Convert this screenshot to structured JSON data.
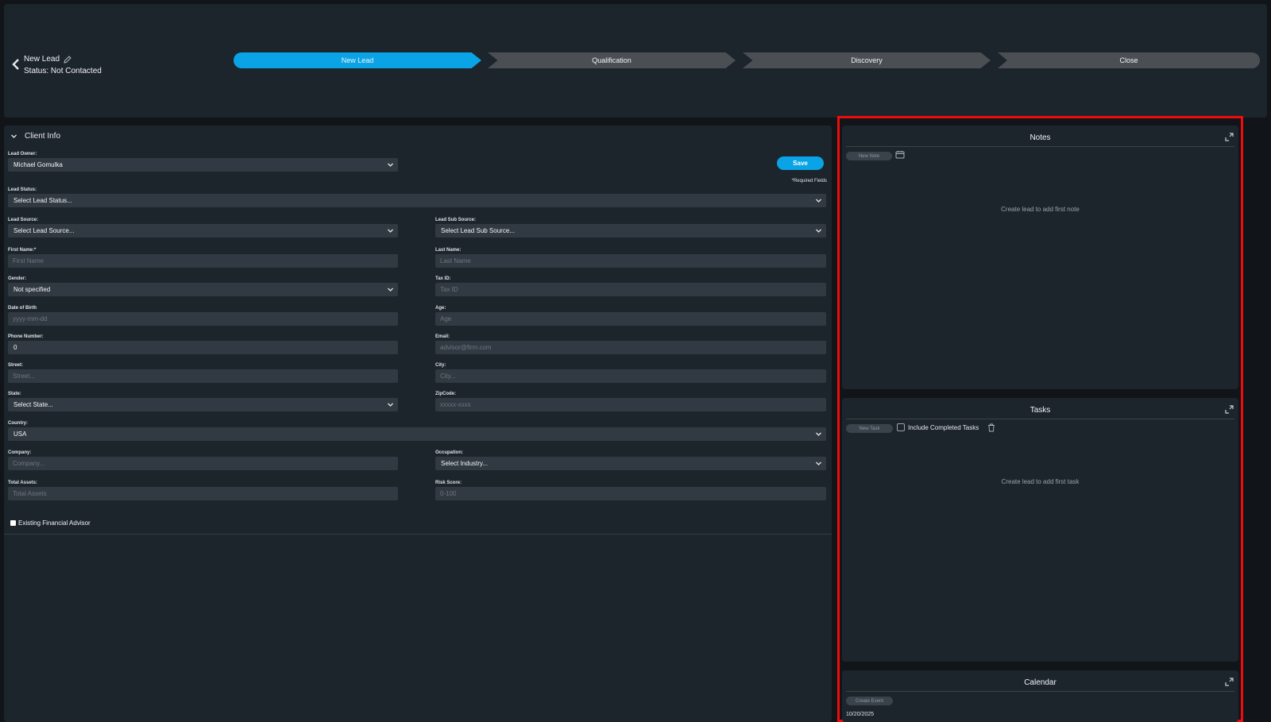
{
  "header": {
    "lead_title": "New Lead",
    "lead_status": "Status: Not Contacted",
    "steps": [
      "New Lead",
      "Qualification",
      "Discovery",
      "Close"
    ]
  },
  "client_info": {
    "section_title": "Client Info",
    "save_label": "Save",
    "required_note": "*Required Fields",
    "fields": {
      "lead_owner": {
        "label": "Lead Owner:",
        "value": "Michael Gomulka"
      },
      "lead_status": {
        "label": "Lead Status:",
        "value": "Select Lead Status..."
      },
      "lead_source": {
        "label": "Lead Source:",
        "value": "Select Lead Source..."
      },
      "lead_sub_source": {
        "label": "Lead Sub Source:",
        "value": "Select Lead Sub Source..."
      },
      "first_name": {
        "label": "First Name:*",
        "placeholder": "First Name"
      },
      "last_name": {
        "label": "Last Name:",
        "placeholder": "Last Name"
      },
      "gender": {
        "label": "Gender:",
        "value": "Not specified"
      },
      "tax_id": {
        "label": "Tax ID:",
        "placeholder": "Tax ID"
      },
      "dob": {
        "label": "Date of Birth",
        "placeholder": "yyyy-mm-dd"
      },
      "age": {
        "label": "Age:",
        "placeholder": "Age"
      },
      "phone": {
        "label": "Phone Number:",
        "value": "0"
      },
      "email": {
        "label": "Email:",
        "placeholder": "advisor@firm.com"
      },
      "street": {
        "label": "Street:",
        "placeholder": "Street..."
      },
      "city": {
        "label": "City:",
        "placeholder": "City..."
      },
      "state": {
        "label": "State:",
        "value": "Select State..."
      },
      "zip": {
        "label": "ZipCode:",
        "placeholder": "xxxxx-xxxx"
      },
      "country": {
        "label": "Country:",
        "value": "USA"
      },
      "company": {
        "label": "Company:",
        "placeholder": "Company..."
      },
      "occupation": {
        "label": "Occupation:",
        "value": "Select Industry..."
      },
      "total_assets": {
        "label": "Total Assets:",
        "placeholder": "Total Assets"
      },
      "risk_score": {
        "label": "Risk Score:",
        "placeholder": "0-100"
      }
    },
    "existing_advisor_label": "Existing Financial Advisor"
  },
  "notes": {
    "title": "Notes",
    "new_button": "New Note",
    "empty_message": "Create lead to add first note"
  },
  "tasks": {
    "title": "Tasks",
    "new_button": "New Task",
    "include_completed_label": "Include Completed Tasks",
    "empty_message": "Create lead to add first task"
  },
  "calendar": {
    "title": "Calendar",
    "create_button": "Create Event",
    "date": "10/20/2025"
  },
  "colors": {
    "accent": "#0aa3e6",
    "highlight": "#ef0c0c",
    "panel": "#1d252c",
    "field": "#313a42"
  }
}
